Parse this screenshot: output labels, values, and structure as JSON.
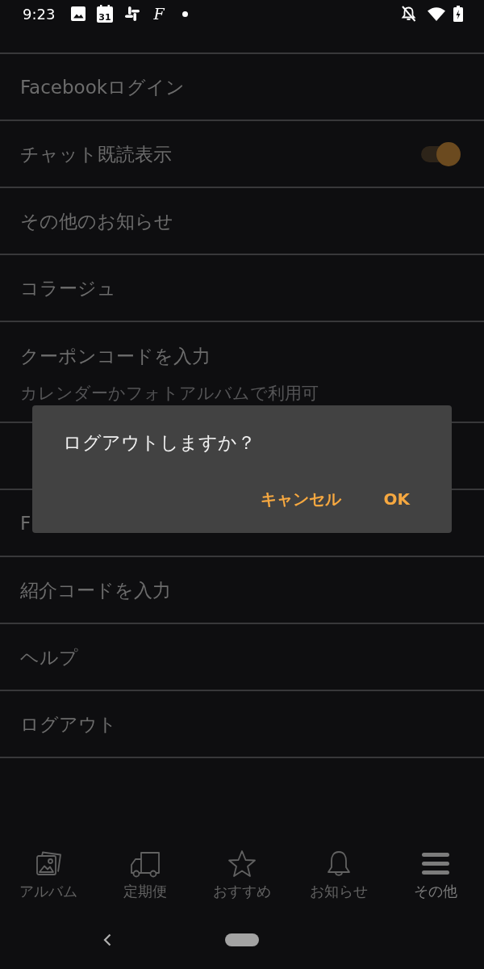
{
  "status_bar": {
    "time": "9:23",
    "calendar_day": "31",
    "app_letter": "F"
  },
  "settings": [
    {
      "kind": "plain",
      "label": "Facebookログイン"
    },
    {
      "kind": "toggle",
      "label": "チャット既読表示",
      "on": true
    },
    {
      "kind": "plain",
      "label": "その他のお知らせ"
    },
    {
      "kind": "plain",
      "label": "コラージュ"
    },
    {
      "kind": "subtitle",
      "label": "クーポンコードを入力",
      "subtitle": "カレンダーかフォトアルバムで利用可"
    },
    {
      "kind": "plain"
    },
    {
      "kind": "plain",
      "label": "F"
    },
    {
      "kind": "plain",
      "label": "紹介コードを入力"
    },
    {
      "kind": "plain",
      "label": "ヘルプ"
    },
    {
      "kind": "plain",
      "label": "ログアウト"
    }
  ],
  "dialog": {
    "message": "ログアウトしますか？",
    "buttons": [
      {
        "label": "キャンセル"
      },
      {
        "label": "OK"
      }
    ]
  },
  "bottom_nav": [
    {
      "label": "アルバム",
      "selected": false
    },
    {
      "label": "定期便",
      "selected": false
    },
    {
      "label": "おすすめ",
      "selected": false
    },
    {
      "label": "お知らせ",
      "selected": false
    },
    {
      "label": "その他",
      "selected": true
    }
  ]
}
